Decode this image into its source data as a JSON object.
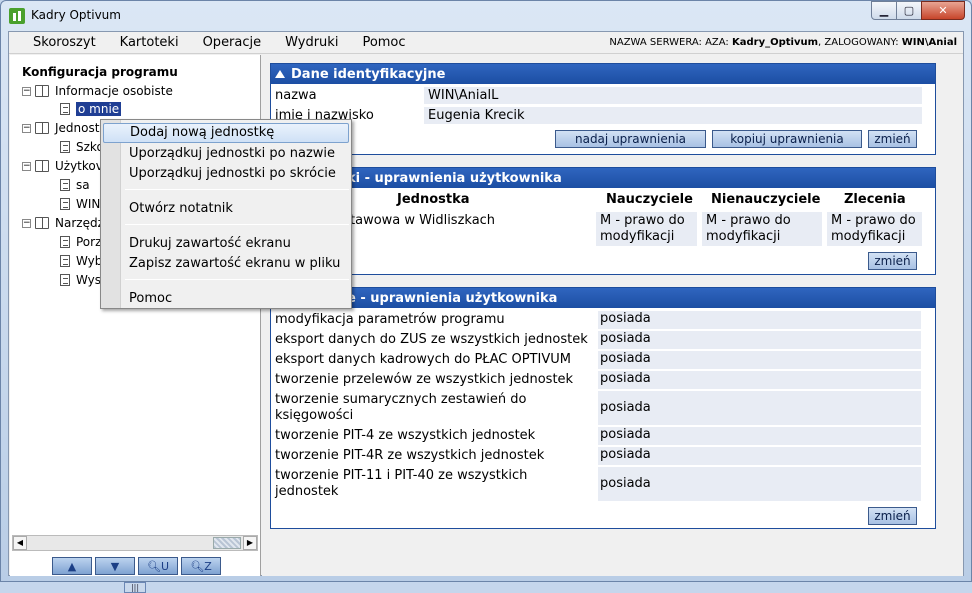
{
  "window": {
    "title": "Kadry Optivum",
    "controls": {
      "minimize": "▁",
      "maximize": "▢",
      "close": "✕"
    }
  },
  "menubar": {
    "items": [
      "Skoroszyt",
      "Kartoteki",
      "Operacje",
      "Wydruki",
      "Pomoc"
    ],
    "server_prefix": "NAZWA SERWERA: ​AZA: ",
    "database": "Kadry_Optivum",
    "logged_prefix": ", ZALOGOWANY: ",
    "user": "WIN\\Anial"
  },
  "tree": {
    "title": "Konfiguracja programu",
    "nodes": [
      {
        "label": "Informacje osobiste",
        "type": "folder"
      },
      {
        "label": "o mnie",
        "type": "doc",
        "selected": true
      },
      {
        "label": "Jednostki",
        "type": "folder"
      },
      {
        "label": "Szkoła",
        "type": "doc"
      },
      {
        "label": "Użytkownicy",
        "type": "folder"
      },
      {
        "label": "sa",
        "type": "doc"
      },
      {
        "label": "WIN\\AnialL",
        "type": "doc"
      },
      {
        "label": "Narzędzia",
        "type": "folder"
      },
      {
        "label": "Porządkowanie",
        "type": "doc"
      },
      {
        "label": "Wybór",
        "type": "doc"
      },
      {
        "label": "Wysyłanie",
        "type": "doc"
      }
    ],
    "visible_labels": {
      "n0": "Informacje osobiste",
      "n1": "o mnie",
      "n2": "Jednost",
      "n3": "Szko",
      "n4": "Użytkov",
      "n5": "sa",
      "n6": "WIN",
      "n7": "Narzędz",
      "n8": "Porz",
      "n9": "Wyb",
      "n10": "Wys"
    },
    "nav_buttons": [
      "up-arrow",
      "down-arrow",
      "search-unit",
      "search-zoom"
    ]
  },
  "ident": {
    "header": "Dane identyfikacyjne",
    "rows": [
      {
        "label": "nazwa",
        "value": "WIN\\AnialL"
      },
      {
        "label": "imię i nazwisko",
        "value": "Eugenia Krecik"
      }
    ],
    "buttons": {
      "grant": "nadaj uprawnienia",
      "copy": "kopiuj uprawnienia",
      "change": "zmień"
    }
  },
  "units": {
    "header": "ki - uprawnienia użytkownika",
    "columns": [
      "Jednostka",
      "Nauczyciele",
      "Nienauczyciele",
      "Zlecenia"
    ],
    "rows": [
      {
        "unit": "tawowa w Widliszkach",
        "nauczyciele": "M - prawo do modyfikacji",
        "nienauczyciele": "M - prawo do modyfikacji",
        "zlecenia": "M - prawo do modyfikacji"
      }
    ],
    "change_button": "zmień"
  },
  "other": {
    "header": "e - uprawnienia użytkownika",
    "rows": [
      {
        "label": "modyfikacja parametrów programu",
        "value": "posiada"
      },
      {
        "label": "eksport danych do ZUS ze wszystkich jednostek",
        "value": "posiada"
      },
      {
        "label": "eksport danych kadrowych do PŁAC OPTIVUM",
        "value": "posiada"
      },
      {
        "label": "tworzenie przelewów ze wszystkich jednostek",
        "value": "posiada"
      },
      {
        "label": "tworzenie sumarycznych zestawień do księgowości",
        "value": "posiada"
      },
      {
        "label": "tworzenie PIT-4 ze wszystkich jednostek",
        "value": "posiada"
      },
      {
        "label": "tworzenie PIT-4R ze wszystkich jednostek",
        "value": "posiada"
      },
      {
        "label": "tworzenie PIT-11 i PIT-40 ze wszystkich jednostek",
        "value": "posiada"
      }
    ],
    "change_button": "zmień"
  },
  "context_menu": {
    "items": [
      "Dodaj nową jednostkę",
      "Uporządkuj jednostki po nazwie",
      "Uporządkuj jednostki po skrócie",
      "Otwórz notatnik",
      "Drukuj zawartość ekranu",
      "Zapisz zawartość ekranu w pliku",
      "Pomoc"
    ],
    "highlighted_index": 0
  },
  "colors": {
    "section_header": "#1c4ea3",
    "selection": "#1f3e94",
    "value_cell": "#e8ecf4",
    "close_button": "#c7452b"
  }
}
